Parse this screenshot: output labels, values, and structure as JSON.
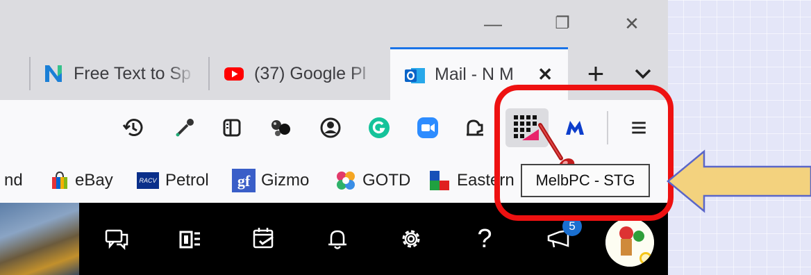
{
  "window": {
    "minimize_glyph": "—",
    "restore_glyph": "❐",
    "close_glyph": "✕"
  },
  "tabs": [
    {
      "title": "Free Text to Sp",
      "icon": "n-logo-icon"
    },
    {
      "title": "(37) Google Pl",
      "icon": "youtube-icon"
    },
    {
      "title": "Mail - N M",
      "icon": "outlook-icon",
      "active": true
    }
  ],
  "tabstrip": {
    "new_tab_glyph": "+",
    "list_tabs_glyph": "⌄",
    "close_tab_glyph": "✕"
  },
  "toolbar": {
    "extensions": [
      "history-icon",
      "eyedropper-icon",
      "reader-view-icon",
      "spheres-icon",
      "account-icon",
      "grammarly-icon",
      "zoom-icon",
      "extension-icon",
      "melbpc-stg-icon",
      "malwarebytes-icon"
    ],
    "menu_glyph": "≡"
  },
  "bookmarks": [
    {
      "label": "nd",
      "icon": ""
    },
    {
      "label": "eBay",
      "icon": "ebay-bag-icon"
    },
    {
      "label": "Petrol",
      "icon": "racv-icon"
    },
    {
      "label": "Gizmo",
      "icon": "gf-icon"
    },
    {
      "label": "GOTD",
      "icon": "gotd-icon"
    },
    {
      "label": "Eastern",
      "icon": "eastern-icon"
    }
  ],
  "tooltip": {
    "text": "MelbPC - STG"
  },
  "appbar": {
    "notification_badge": "5",
    "help_glyph": "?"
  },
  "colors": {
    "highlight": "#ee1111",
    "arrow_fill": "#f3d27e",
    "arrow_stroke": "#5a66c8",
    "active_tab_accent": "#1a73e8"
  }
}
